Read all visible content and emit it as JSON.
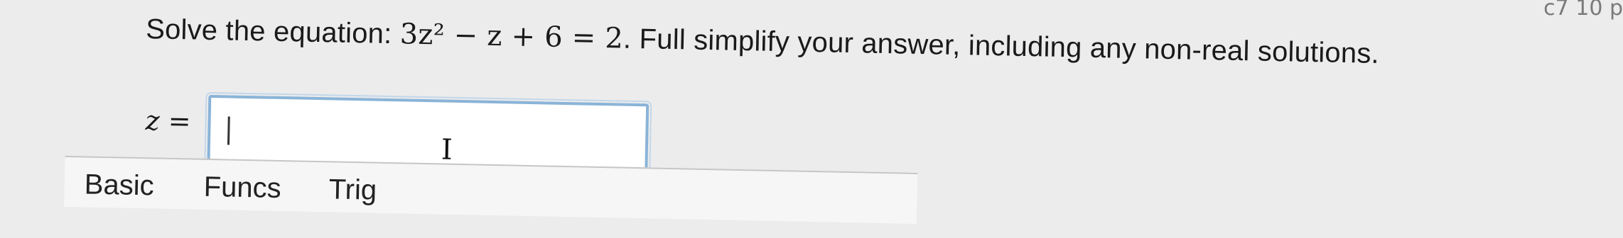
{
  "question": {
    "prefix": "Solve the equation: ",
    "equation": "3z² − z + 6 = 2",
    "suffix": ". Full simplify your answer, including any non-real solutions."
  },
  "answer": {
    "label": "z =",
    "value": ""
  },
  "toolbar": {
    "tabs": [
      "Basic",
      "Funcs",
      "Trig"
    ]
  },
  "corner_fragment": "c7 10 p",
  "colors": {
    "input_border": "#8ab4d8",
    "page_background": "#ececec"
  }
}
